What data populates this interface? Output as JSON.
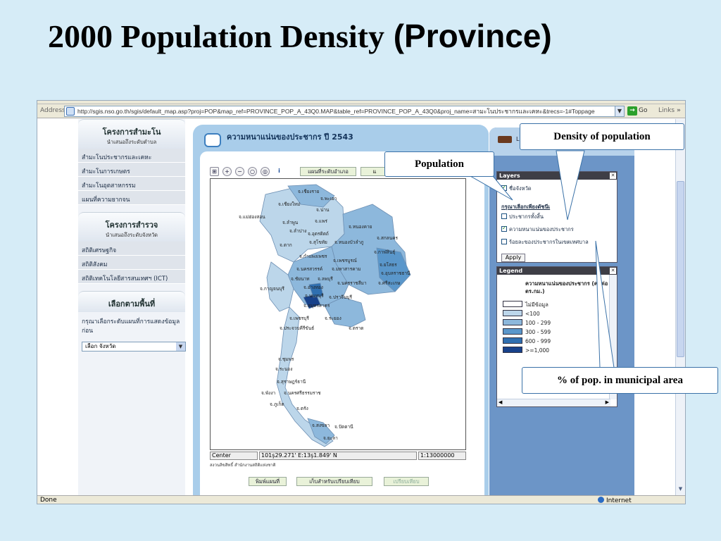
{
  "slide": {
    "title_part1": "2000 Population Density",
    "title_part2": " (Province)"
  },
  "browser": {
    "address_label": "Address",
    "url": "http://sgis.nso.go.th/sgis/default_map.asp?proj=POP&map_ref=PROVINCE_POP_A_43Q0.MAP&table_ref=PROVINCE_POP_A_43Q0&proj_name=สามะโนประชากรและเคหะ&trecs=-1#Toppage",
    "go_label": "Go",
    "links_label": "Links",
    "status_done": "Done",
    "status_zone": "Internet"
  },
  "sidebar": {
    "section1_title": "โครงการสำมะโน",
    "section1_sub": "นำเสนอถึงระดับตำบล",
    "section1_items": [
      "สำมะโนประชากรและเคหะ",
      "สำมะโนการเกษตร",
      "สำมะโนอุตสาหกรรม",
      "แผนที่ความยากจน"
    ],
    "section2_title": "โครงการสำรวจ",
    "section2_sub": "นำเสนอถึงระดับจังหวัด",
    "section2_items": [
      "สถิติเศรษฐกิจ",
      "สถิติสังคม",
      "สถิติเทคโนโลยีสารสนเทศฯ (ICT)"
    ],
    "section3_title": "เลือกตามพื้นที่",
    "section3_note": "กรุณาเลือกระดับแผนที่การแสดงข้อมูลก่อน",
    "province_select": "เลือก จังหวัด"
  },
  "main": {
    "title": "ความหนาแน่นของประชากร ปี 2543",
    "toolbar_level": "แผนที่ระดับอำเภอ",
    "toolbar_level2": "แ",
    "coord_center": "Center",
    "coord_value": "101ş29.271' E:13ş1.849' N",
    "scale": "1:13000000",
    "copyright": "สงวนลิขสิทธิ์ สำนักงานสถิติแห่งชาติ",
    "btn_print": "พิมพ์แผนที่",
    "btn_save_compare": "เก็บสำหรับเปรียบเทียบ",
    "btn_compare": "เปรียบเทียบ"
  },
  "map": {
    "labels": [
      "จ.เชียงราย",
      "จ.พะเยา",
      "จ.เชียงใหม่",
      "จ.น่าน",
      "จ.แม่ฮ่องสอน",
      "จ.ลำพูน",
      "จ.แพร่",
      "จ.ลำปาง",
      "จ.หนองคาย",
      "จ.อุตรดิตถ์",
      "จ.สกลนคร",
      "จ.ตาก",
      "จ.สุโขทัย",
      "จ.หนองบัวลำภู",
      "จ.กาฬสินธุ์",
      "จ.กำแพงเพชร",
      "จ.เพชรบูรณ์",
      "จ.ยโสธร",
      "จ.นครสวรรค์",
      "จ.มหาสารคาม",
      "จ.อุบลราชธานี",
      "จ.ชัยนาท",
      "จ.ลพบุรี",
      "จ.นครราชสีมา",
      "จ.ศรีสะเกษ",
      "จ.กาญจนบุรี",
      "จ.อ่างทอง",
      "จ.นนทบุรี",
      "จ.ปราจีนบุรี",
      "จ.สมุทรสาคร",
      "จ.เพชรบุรี",
      "จ.ระยอง",
      "จ.ประจวบคีรีขันธ์",
      "จ.ตราด",
      "จ.ชุมพร",
      "จ.ระนอง",
      "จ.สุราษฎร์ธานี",
      "จ.พังงา",
      "จ.นครศรีธรรมราช",
      "จ.ภูเก็ต",
      "จ.ตรัง",
      "จ.สงขลา",
      "จ.ปัตตานี",
      "จ.ยะลา"
    ]
  },
  "layers": {
    "title": "Layers",
    "province_name": "ชื่อจังหวัด",
    "subheading": "กรุณาเลือกเพียงดัชนีเ",
    "opt_total": "ประชากรทั้งสิ้น",
    "opt_density": "ความหนาแน่นของประชากร",
    "opt_municipal": "ร้อยละของประชากรในเขตเทศบาล",
    "apply": "Apply"
  },
  "legend": {
    "title": "Legend",
    "heading": "ความหนาแน่นของประชากร (คนต่อตร.กม.)",
    "classes": [
      {
        "label": "ไม่มีข้อมูล",
        "color": "#ffffff"
      },
      {
        "label": "<100",
        "color": "#bcd6ea"
      },
      {
        "label": "100 - 299",
        "color": "#8db8dc"
      },
      {
        "label": "300 - 599",
        "color": "#5a97cb"
      },
      {
        "label": "600 - 999",
        "color": "#2f6fb0"
      },
      {
        "label": ">=1,000",
        "color": "#17418a"
      }
    ]
  },
  "callouts": {
    "density": "Density of population",
    "population": "Population",
    "municipal": "% of pop. in municipal area"
  },
  "rightpanel": {
    "head_text": "L"
  }
}
